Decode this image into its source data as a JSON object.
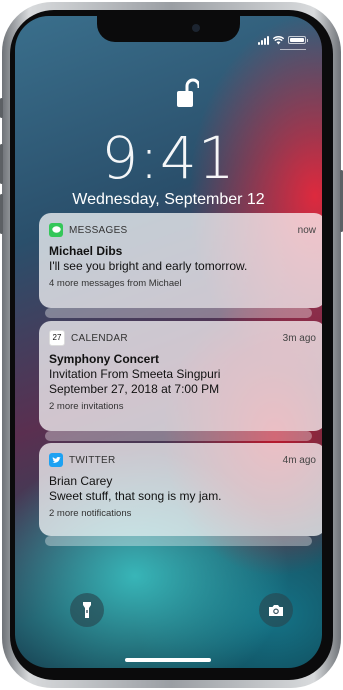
{
  "status_bar": {
    "signal_icon": "cellular-signal-icon",
    "wifi_icon": "wifi-icon",
    "battery_icon": "battery-icon"
  },
  "lock_screen": {
    "lock_icon": "unlocked-padlock-icon",
    "time": "9:41",
    "date": "Wednesday, September 12"
  },
  "notifications": [
    {
      "app": "MESSAGES",
      "icon": "messages-icon",
      "icon_color": "#34c759",
      "time_ago": "now",
      "title": "Michael Dibs",
      "body_lines": [
        "I'll see you bright and early tomorrow."
      ],
      "more": "4 more messages from Michael"
    },
    {
      "app": "CALENDAR",
      "icon": "calendar-icon",
      "icon_day": "27",
      "icon_color": "#ffffff",
      "time_ago": "3m ago",
      "title": "Symphony Concert",
      "body_lines": [
        "Invitation From Smeeta Singpuri",
        "September 27, 2018 at 7:00 PM"
      ],
      "more": "2 more invitations"
    },
    {
      "app": "TWITTER",
      "icon": "twitter-icon",
      "icon_color": "#1da1f2",
      "time_ago": "4m ago",
      "title": "",
      "body_lines": [
        "Brian Carey",
        "Sweet stuff, that song is my jam."
      ],
      "more": "2 more notifications"
    }
  ],
  "quick_actions": {
    "left": "flashlight-icon",
    "right": "camera-icon"
  }
}
